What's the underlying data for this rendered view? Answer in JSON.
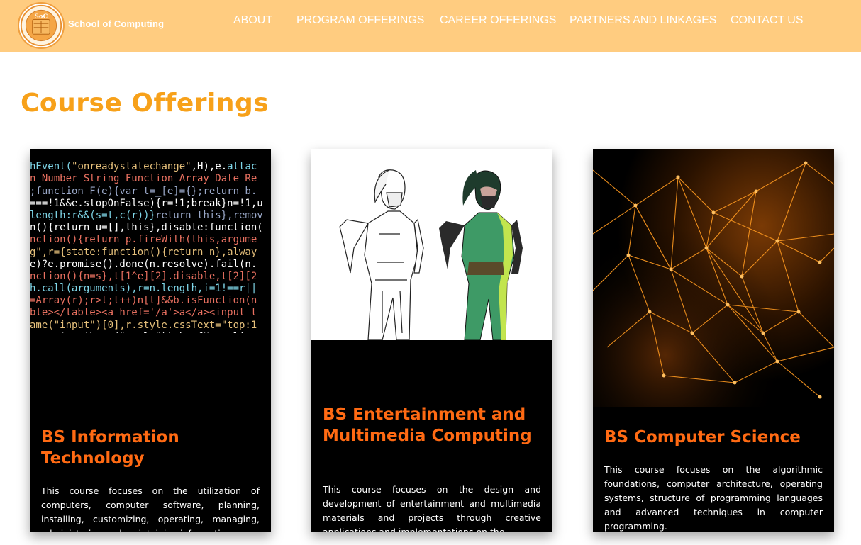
{
  "header": {
    "logo_text": "SoC",
    "brand": "School of Computing",
    "nav": [
      {
        "label": "ABOUT",
        "key": "about"
      },
      {
        "label": "PROGRAM OFFERINGS",
        "key": "program-offerings"
      },
      {
        "label": "CAREER OFFERINGS",
        "key": "career-offerings"
      },
      {
        "label": "PARTNERS AND LINKAGES",
        "key": "partners-and-linkages"
      },
      {
        "label": "CONTACT US",
        "key": "contact-us"
      }
    ]
  },
  "main": {
    "title": "Course Offerings",
    "cards": [
      {
        "title": "BS Information Technology",
        "description": "This course focuses on the utilization of computers, computer software, planning, installing, customizing, operating, managing, administering and maintaining information"
      },
      {
        "title": "BS Entertainment and Multimedia Computing",
        "description": "This course focuses on the design and development of entertainment and multimedia materials and projects through creative applications and implementations on the"
      },
      {
        "title": "BS Computer Science",
        "description": "This course focuses on the algorithmic foundations, computer architecture, operating systems, structure of programming languages and advanced techniques in computer programming."
      }
    ]
  },
  "colors": {
    "header_bg": "#ffcc80",
    "title": "#f7a11a",
    "card_title": "#ff6a13",
    "card_bg": "#000000"
  }
}
